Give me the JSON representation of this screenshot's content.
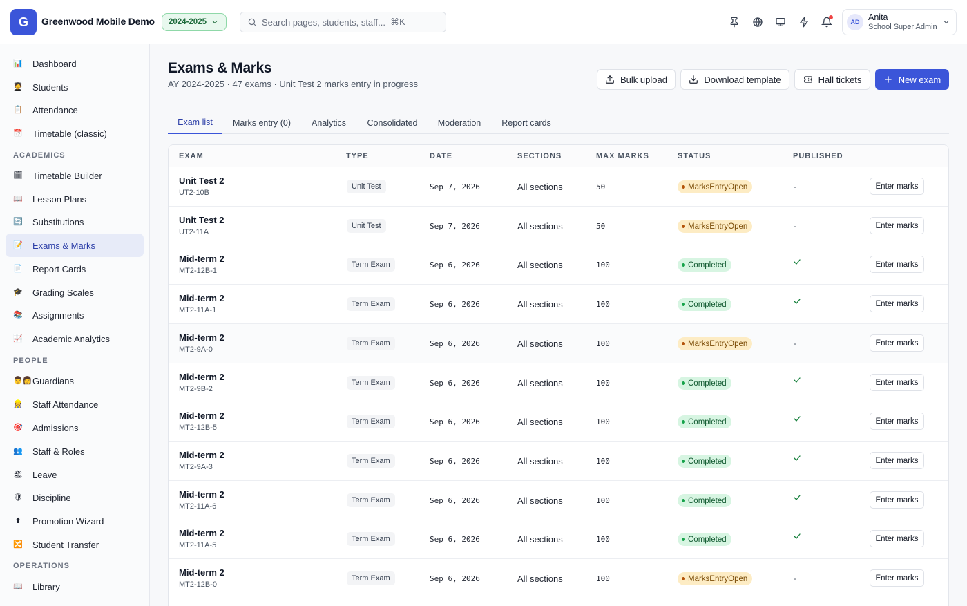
{
  "app": {
    "logo_letter": "G",
    "name": "Greenwood Mobile Demo",
    "year": "2024-2025"
  },
  "search": {
    "placeholder": "Search pages, students, staff...",
    "shortcut": "⌘K"
  },
  "user": {
    "initials": "AD",
    "name": "Anita",
    "role": "School Super Admin"
  },
  "sidebar": {
    "items": [
      {
        "label": "Dashboard",
        "icon": "📊"
      },
      {
        "label": "Students",
        "icon": "🧑‍🎓"
      },
      {
        "label": "Attendance",
        "icon": "📋"
      },
      {
        "label": "Timetable (classic)",
        "icon": "📅"
      }
    ],
    "academics_label": "ACADEMICS",
    "academics": [
      {
        "label": "Timetable Builder",
        "icon": "🗓"
      },
      {
        "label": "Lesson Plans",
        "icon": "📖"
      },
      {
        "label": "Substitutions",
        "icon": "🔄"
      },
      {
        "label": "Exams & Marks",
        "icon": "📝"
      },
      {
        "label": "Report Cards",
        "icon": "📄"
      },
      {
        "label": "Grading Scales",
        "icon": "🎓"
      },
      {
        "label": "Assignments",
        "icon": "📚"
      },
      {
        "label": "Academic Analytics",
        "icon": "📈"
      }
    ],
    "people_label": "PEOPLE",
    "people": [
      {
        "label": "Guardians",
        "icon": "👨‍👩"
      },
      {
        "label": "Staff Attendance",
        "icon": "👷"
      },
      {
        "label": "Admissions",
        "icon": "🎯"
      },
      {
        "label": "Staff & Roles",
        "icon": "👥"
      },
      {
        "label": "Leave",
        "icon": "🏖"
      },
      {
        "label": "Discipline",
        "icon": "🛡"
      },
      {
        "label": "Promotion Wizard",
        "icon": "⬆"
      },
      {
        "label": "Student Transfer",
        "icon": "🔀"
      }
    ],
    "operations_label": "OPERATIONS",
    "operations": [
      {
        "label": "Library",
        "icon": "📖"
      }
    ]
  },
  "page": {
    "title": "Exams & Marks",
    "subtitle": "AY 2024-2025 · 47 exams · Unit Test 2 marks entry in progress",
    "buttons": {
      "bulk_upload": "Bulk upload",
      "download_template": "Download template",
      "hall_tickets": "Hall tickets",
      "new_exam": "New exam"
    }
  },
  "tabs": [
    "Exam list",
    "Marks entry (0)",
    "Analytics",
    "Consolidated",
    "Moderation",
    "Report cards"
  ],
  "table": {
    "headers": [
      "EXAM",
      "TYPE",
      "DATE",
      "SECTIONS",
      "MAX MARKS",
      "STATUS",
      "PUBLISHED"
    ],
    "action_label": "Enter marks",
    "rows": [
      {
        "name": "Unit Test 2",
        "code": "UT2-10B",
        "type": "Unit Test",
        "date": "Sep 7, 2026",
        "sections": "All sections",
        "max": "50",
        "status": "MarksEntryOpen",
        "published": "-"
      },
      {
        "name": "Unit Test 2",
        "code": "UT2-11A",
        "type": "Unit Test",
        "date": "Sep 7, 2026",
        "sections": "All sections",
        "max": "50",
        "status": "MarksEntryOpen",
        "published": "-"
      },
      {
        "name": "Mid-term 2",
        "code": "MT2-12B-1",
        "type": "Term Exam",
        "date": "Sep 6, 2026",
        "sections": "All sections",
        "max": "100",
        "status": "Completed",
        "published": "✓"
      },
      {
        "name": "Mid-term 2",
        "code": "MT2-11A-1",
        "type": "Term Exam",
        "date": "Sep 6, 2026",
        "sections": "All sections",
        "max": "100",
        "status": "Completed",
        "published": "✓"
      },
      {
        "name": "Mid-term 2",
        "code": "MT2-9A-0",
        "type": "Term Exam",
        "date": "Sep 6, 2026",
        "sections": "All sections",
        "max": "100",
        "status": "MarksEntryOpen",
        "published": "-"
      },
      {
        "name": "Mid-term 2",
        "code": "MT2-9B-2",
        "type": "Term Exam",
        "date": "Sep 6, 2026",
        "sections": "All sections",
        "max": "100",
        "status": "Completed",
        "published": "✓"
      },
      {
        "name": "Mid-term 2",
        "code": "MT2-12B-5",
        "type": "Term Exam",
        "date": "Sep 6, 2026",
        "sections": "All sections",
        "max": "100",
        "status": "Completed",
        "published": "✓"
      },
      {
        "name": "Mid-term 2",
        "code": "MT2-9A-3",
        "type": "Term Exam",
        "date": "Sep 6, 2026",
        "sections": "All sections",
        "max": "100",
        "status": "Completed",
        "published": "✓"
      },
      {
        "name": "Mid-term 2",
        "code": "MT2-11A-6",
        "type": "Term Exam",
        "date": "Sep 6, 2026",
        "sections": "All sections",
        "max": "100",
        "status": "Completed",
        "published": "✓"
      },
      {
        "name": "Mid-term 2",
        "code": "MT2-11A-5",
        "type": "Term Exam",
        "date": "Sep 6, 2026",
        "sections": "All sections",
        "max": "100",
        "status": "Completed",
        "published": "✓"
      },
      {
        "name": "Mid-term 2",
        "code": "MT2-12B-0",
        "type": "Term Exam",
        "date": "Sep 6, 2026",
        "sections": "All sections",
        "max": "100",
        "status": "MarksEntryOpen",
        "published": "-"
      }
    ]
  },
  "colors": {
    "accent": "#3b55d9",
    "open_bg": "#fdecc4",
    "done_bg": "#d7f5e2"
  }
}
